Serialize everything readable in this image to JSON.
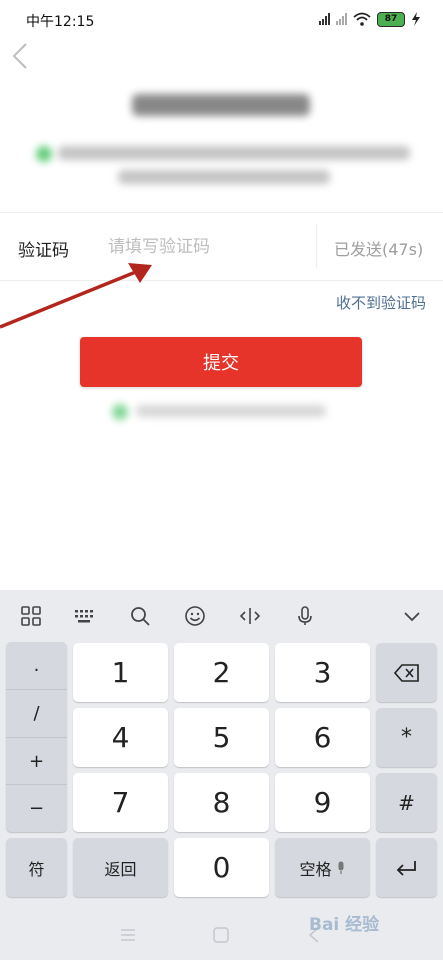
{
  "status_bar": {
    "time": "中午12:15",
    "battery": "87",
    "icons": [
      "hd-signal-icon",
      "signal-icon",
      "wifi-icon",
      "battery-icon",
      "charging-icon"
    ]
  },
  "header": {
    "back_icon": "chevron-left-icon"
  },
  "form": {
    "code_label": "验证码",
    "code_placeholder": "请填写验证码",
    "code_value": "",
    "resend_status": "已发送(47s)",
    "no_code_link": "收不到验证码",
    "submit_label": "提交"
  },
  "annotation": {
    "arrow_color": "#b3261e"
  },
  "keyboard": {
    "toolbar_icons": [
      "grid-menu-icon",
      "keyboard-icon",
      "search-icon",
      "emoji-icon",
      "cursor-move-icon",
      "microphone-icon",
      "chevron-down-icon"
    ],
    "symbols": [
      ".",
      "/",
      "+",
      "−"
    ],
    "digits": [
      "1",
      "2",
      "3",
      "4",
      "5",
      "6",
      "7",
      "8",
      "9",
      "0"
    ],
    "delete_icon": "backspace-icon",
    "star": "*",
    "hash": "#",
    "fu": "符",
    "back_label": "返回",
    "space_label": "空格",
    "enter_icon": "enter-icon"
  },
  "colors": {
    "accent_red": "#e6342a",
    "link_blue": "#4f6f94",
    "green": "#2ebd4f",
    "battery_green": "#4caf50"
  },
  "watermark": {
    "text": "Bai 经验"
  }
}
